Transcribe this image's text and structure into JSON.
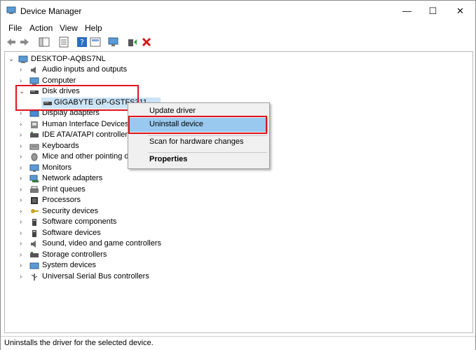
{
  "window": {
    "title": "Device Manager",
    "controls": {
      "minimize": "—",
      "maximize": "☐",
      "close": "✕"
    }
  },
  "menu": [
    "File",
    "Action",
    "View",
    "Help"
  ],
  "toolbar_icons": [
    "back-arrow-icon",
    "forward-arrow-icon",
    "show-hide-tree-icon",
    "properties-icon",
    "help-icon",
    "view-icon",
    "scan-hardware-icon",
    "enable-device-icon",
    "uninstall-x-icon"
  ],
  "tree": {
    "root": "DESKTOP-AQBS7NL",
    "items": [
      "Audio inputs and outputs",
      "Computer",
      "Disk drives",
      "GIGABYTE GP-GSTFS311",
      "Display adapters",
      "Human Interface Devices",
      "IDE ATA/ATAPI controllers",
      "Keyboards",
      "Mice and other pointing de",
      "Monitors",
      "Network adapters",
      "Print queues",
      "Processors",
      "Security devices",
      "Software components",
      "Software devices",
      "Sound, video and game controllers",
      "Storage controllers",
      "System devices",
      "Universal Serial Bus controllers"
    ]
  },
  "context_menu": {
    "items": [
      "Update driver",
      "Uninstall device",
      "Scan for hardware changes",
      "Properties"
    ],
    "highlighted": "Uninstall device"
  },
  "status": "Uninstalls the driver for the selected device.",
  "colors": {
    "highlight": "#99c9ef",
    "annotation": "#e0141e",
    "accent": "#2b6cc4"
  }
}
